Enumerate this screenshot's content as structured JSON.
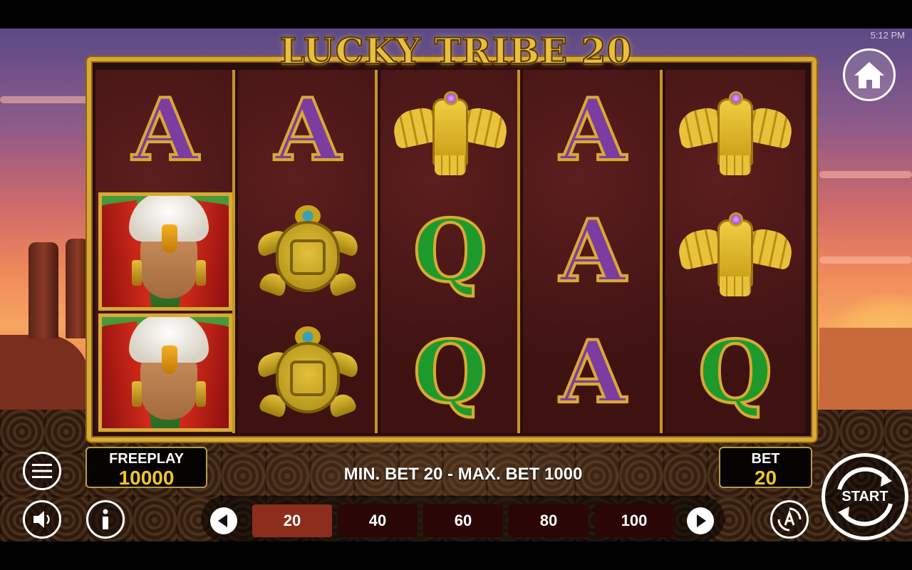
{
  "status": {
    "time": "5:12 PM"
  },
  "game": {
    "title": "LUCKY TRIBE 20"
  },
  "reels": [
    [
      "A",
      "chief",
      "chief"
    ],
    [
      "A",
      "turtle",
      "turtle"
    ],
    [
      "eagle-totem",
      "Q",
      "Q"
    ],
    [
      "A",
      "A",
      "A"
    ],
    [
      "eagle-totem",
      "eagle-totem",
      "Q"
    ]
  ],
  "credits": {
    "label": "FREEPLAY",
    "value": "10000"
  },
  "bet": {
    "label": "BET",
    "value": "20",
    "limits_text": "MIN. BET 20 - MAX. BET 1000"
  },
  "bet_options": [
    "20",
    "40",
    "60",
    "80",
    "100"
  ],
  "selected_bet_index": 0,
  "start": {
    "label": "START"
  },
  "colors": {
    "gold": "#d9a933",
    "bet_value": "#f2c626",
    "selected_bet": "#8c2d1e",
    "reel_bg": "#3f1212"
  }
}
